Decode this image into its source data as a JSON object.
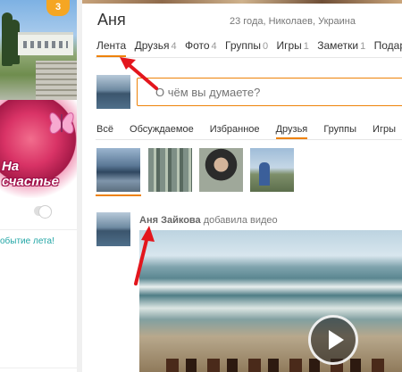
{
  "left": {
    "badge": "3",
    "sticker_text": "На счастье",
    "link_text": "обытие лета!"
  },
  "profile": {
    "name": "Аня",
    "info": "23 года, Николаев, Украина"
  },
  "nav": [
    {
      "label": "Лента",
      "count": ""
    },
    {
      "label": "Друзья",
      "count": "4"
    },
    {
      "label": "Фото",
      "count": "4"
    },
    {
      "label": "Группы",
      "count": "0"
    },
    {
      "label": "Игры",
      "count": "1"
    },
    {
      "label": "Заметки",
      "count": "1"
    },
    {
      "label": "Подарк",
      "count": ""
    }
  ],
  "post": {
    "placeholder": "О чём вы думаете?"
  },
  "filters": [
    "Всё",
    "Обсуждаемое",
    "Избранное",
    "Друзья",
    "Группы",
    "Игры"
  ],
  "activity": {
    "author": "Аня Зайкова",
    "action": "добавила видео"
  },
  "colors": {
    "accent": "#ee8208",
    "arrow": "#e3161d",
    "link": "#22a6a6"
  }
}
